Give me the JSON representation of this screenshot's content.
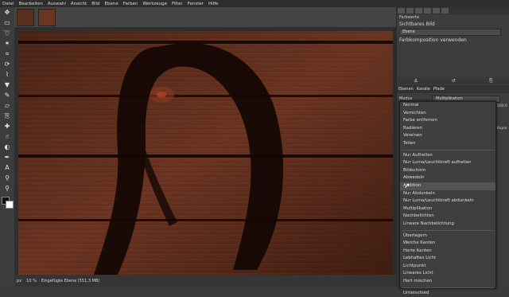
{
  "menu": [
    "Datei",
    "Bearbeiten",
    "Auswahl",
    "Ansicht",
    "Bild",
    "Ebene",
    "Farben",
    "Werkzeuge",
    "Filter",
    "Fenster",
    "Hilfe"
  ],
  "status": {
    "unit": "px",
    "zoom": "10 %",
    "info": "Eingefügte Ebene (551,3 MB)"
  },
  "dock": {
    "title": "Farbwerte",
    "line1": "Sichtbares Bild",
    "line2": "Ebene",
    "line3": "Farbkomposition verwenden"
  },
  "layers": {
    "tabs": [
      "Ebenen",
      "Kanäle",
      "Pfade"
    ],
    "mode_label": "Modus",
    "mode_value": "Multiplikation",
    "side_label1": "100,0",
    "side_label2": "Kopie"
  },
  "blend_modes": {
    "group1": [
      "Normal",
      "Vernichten",
      "Farbe entfernen",
      "Radieren",
      "Vereinen",
      "Teilen"
    ],
    "group2": [
      "Nur Aufhellen",
      "Nur Luma/Leuchtkraft aufhellen",
      "Bildschirm",
      "Abwedeln",
      "Addition"
    ],
    "group3": [
      "Nur Abdunkeln",
      "Nur Luma/Leuchtkraft abdunkeln",
      "Multiplikation",
      "Nachbelichten",
      "Lineare Nachbelichtung"
    ],
    "group4": [
      "Überlagern",
      "Weiche Kanten",
      "Harte Kanten",
      "Lebhaftes Licht",
      "Lichtpunkt",
      "Lineares Licht",
      "Hart mischen"
    ],
    "group5": [
      "Unterschied"
    ],
    "selected": "Addition"
  },
  "colors": {
    "wood_base": "#5a2c1c",
    "wood_dark": "#2e130b",
    "hair": "#140604"
  }
}
